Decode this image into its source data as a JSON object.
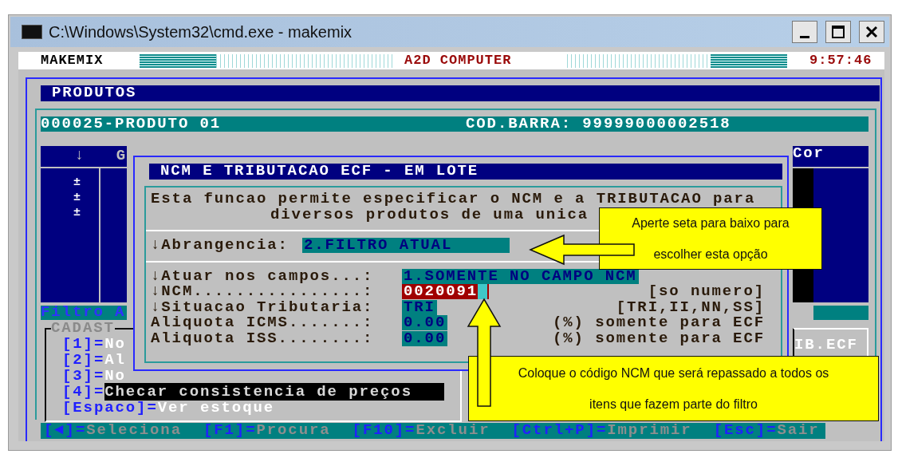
{
  "window": {
    "title": "C:\\Windows\\System32\\cmd.exe - makemix"
  },
  "header": {
    "app": "MAKEMIX",
    "company": "A2D COMPUTER",
    "time": "9:57:46"
  },
  "screen_title": "PRODUTOS",
  "product": {
    "name": "000025-PRODUTO 01",
    "barcode": "COD.BARRA: 99999000002518"
  },
  "table": {
    "columns": [
      "↓",
      "G"
    ],
    "rows": [
      "±",
      "±",
      "±"
    ]
  },
  "filter_bar": "Filtro A",
  "right_panel": {
    "header": "Cor",
    "label": "IB.ECF"
  },
  "cadastro": {
    "title": "CADAST",
    "items": [
      {
        "key": "[1]=",
        "label": "No",
        "highlighted": false
      },
      {
        "key": "[2]=",
        "label": "Al",
        "highlighted": false
      },
      {
        "key": "[3]=",
        "label": "No",
        "highlighted": false
      },
      {
        "key": "[4]=",
        "label": "Checar consistencia de preços",
        "highlighted": true
      },
      {
        "key": "[Espaco]=",
        "label": "Ver estoque",
        "highlighted": false
      }
    ]
  },
  "dialog": {
    "title": "NCM E TRIBUTACAO ECF - EM LOTE",
    "description": [
      "Esta funcao permite especificar o NCM e a TRIBUTACAO para",
      "diversos produtos de uma unica"
    ],
    "scope": {
      "label": "↓Abrangencia:",
      "value": "2.FILTRO ATUAL"
    },
    "fields": [
      {
        "label": "↓Atuar nos campos...:",
        "value": "1.SOMENTE NO CAMPO NCM",
        "focused": false
      },
      {
        "label": "↓NCM................:",
        "value": "0020091",
        "focused": true,
        "hint": "[so numero]"
      },
      {
        "label": "↓Situacao Tributaria:",
        "value": "TRI",
        "focused": false,
        "hint": "[TRI,II,NN,SS]"
      },
      {
        "label": "Aliquota ICMS.......:",
        "value": "0.00",
        "focused": false,
        "hint": "(%) somente para ECF"
      },
      {
        "label": "Aliquota ISS........:",
        "value": "0.00",
        "focused": false,
        "hint": "(%) somente para ECF"
      }
    ]
  },
  "shortcuts": [
    {
      "key": "[◄]=",
      "label": "Seleciona"
    },
    {
      "key": "[F1]=",
      "label": "Procura"
    },
    {
      "key": "[F10]=",
      "label": "Excluir"
    },
    {
      "key": "[Ctrl+P]=",
      "label": "Imprimir"
    },
    {
      "key": "[Esc]=",
      "label": "Sair"
    }
  ],
  "callouts": [
    {
      "lines": [
        "Aperte seta para baixo para",
        "escolher esta opção"
      ]
    },
    {
      "lines": [
        "Coloque o código NCM que será repassado a todos os",
        "itens que fazem parte do filtro"
      ]
    }
  ]
}
